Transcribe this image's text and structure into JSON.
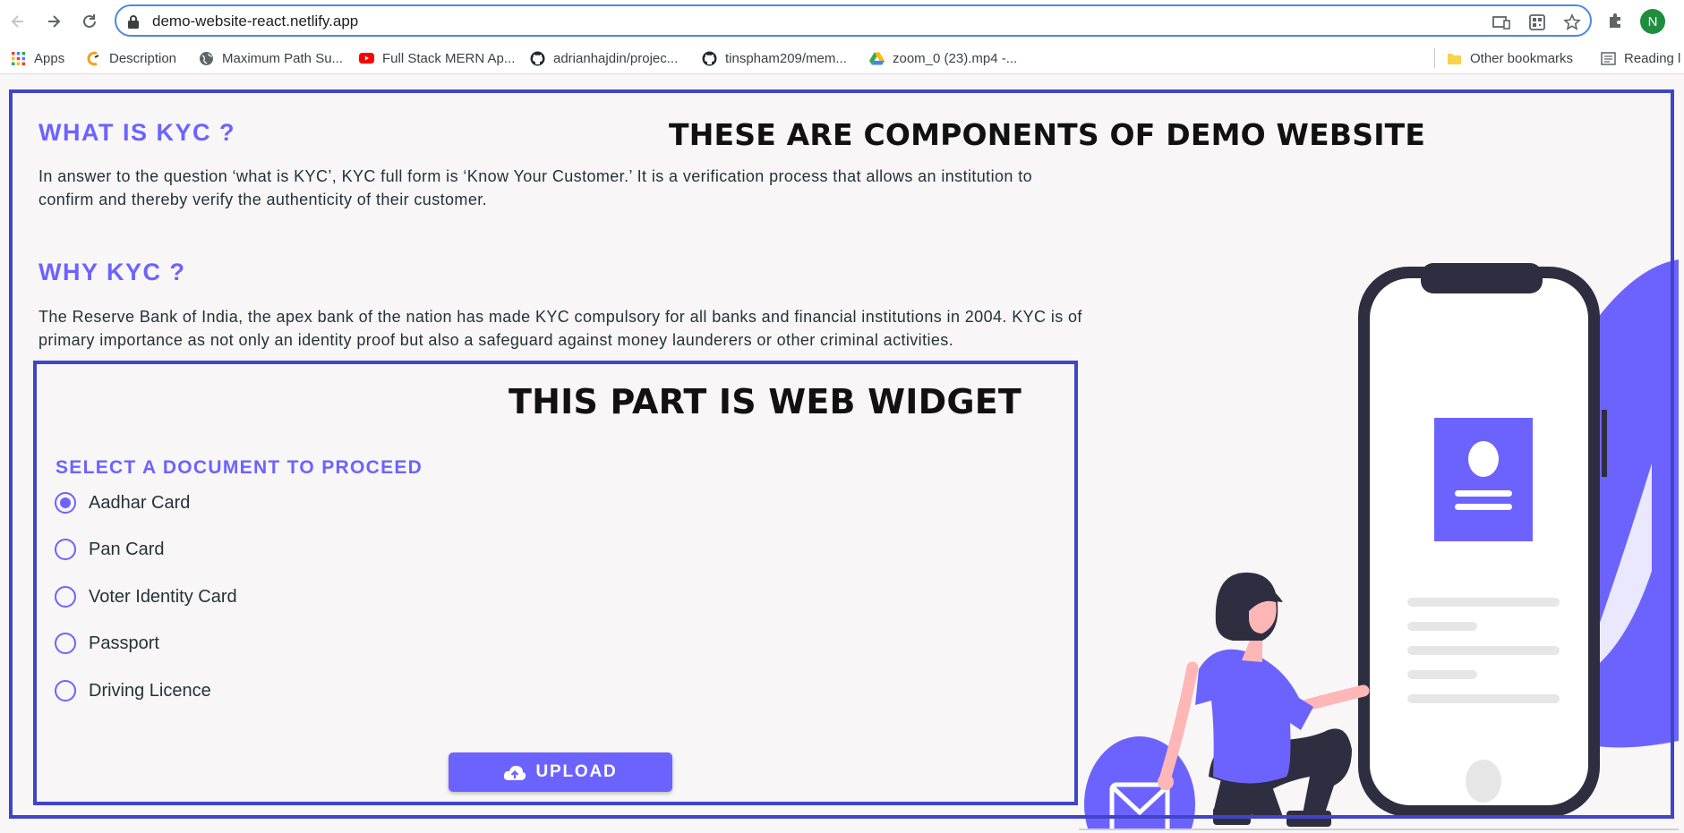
{
  "browser": {
    "url": "demo-website-react.netlify.app",
    "profile_initial": "N",
    "bookmarks": [
      {
        "label": "Apps",
        "icon": "apps-grid-icon"
      },
      {
        "label": "Description",
        "icon": "site-favicon-icon"
      },
      {
        "label": "Maximum Path Su...",
        "icon": "globe-icon"
      },
      {
        "label": "Full Stack MERN Ap...",
        "icon": "youtube-icon"
      },
      {
        "label": "adrianhajdin/projec...",
        "icon": "github-icon"
      },
      {
        "label": "tinspham209/mem...",
        "icon": "github-icon"
      },
      {
        "label": "zoom_0 (23).mp4 -...",
        "icon": "google-drive-icon"
      }
    ],
    "other_bookmarks": "Other bookmarks",
    "reading_list": "Reading l"
  },
  "page": {
    "annotation_top": "THESE ARE COMPONENTS OF DEMO WEBSITE",
    "what_heading": "WHAT IS KYC ?",
    "what_text": "In answer to the question ‘what is KYC’, KYC full form is ‘Know Your Customer.’ It is a verification process that allows an institution to confirm and thereby verify the authenticity of their customer.",
    "why_heading": "WHY KYC ?",
    "why_text": "The Reserve Bank of India, the apex bank of the nation has made KYC compulsory for all banks and financial institutions in 2004. KYC is of primary importance as not only an identity proof but also a safeguard against money launderers or other criminal activities."
  },
  "widget": {
    "annotation": "THIS PART IS WEB WIDGET",
    "title": "SELECT A DOCUMENT TO PROCEED",
    "options": [
      {
        "label": "Aadhar Card",
        "selected": true
      },
      {
        "label": "Pan Card",
        "selected": false
      },
      {
        "label": "Voter Identity Card",
        "selected": false
      },
      {
        "label": "Passport",
        "selected": false
      },
      {
        "label": "Driving Licence",
        "selected": false
      }
    ],
    "upload_label": "UPLOAD"
  },
  "colors": {
    "accent": "#6c63ff",
    "frame": "#3f45c8",
    "dark": "#2f2e41",
    "skin": "#ffb6b6",
    "background": "#f8f6f6"
  }
}
